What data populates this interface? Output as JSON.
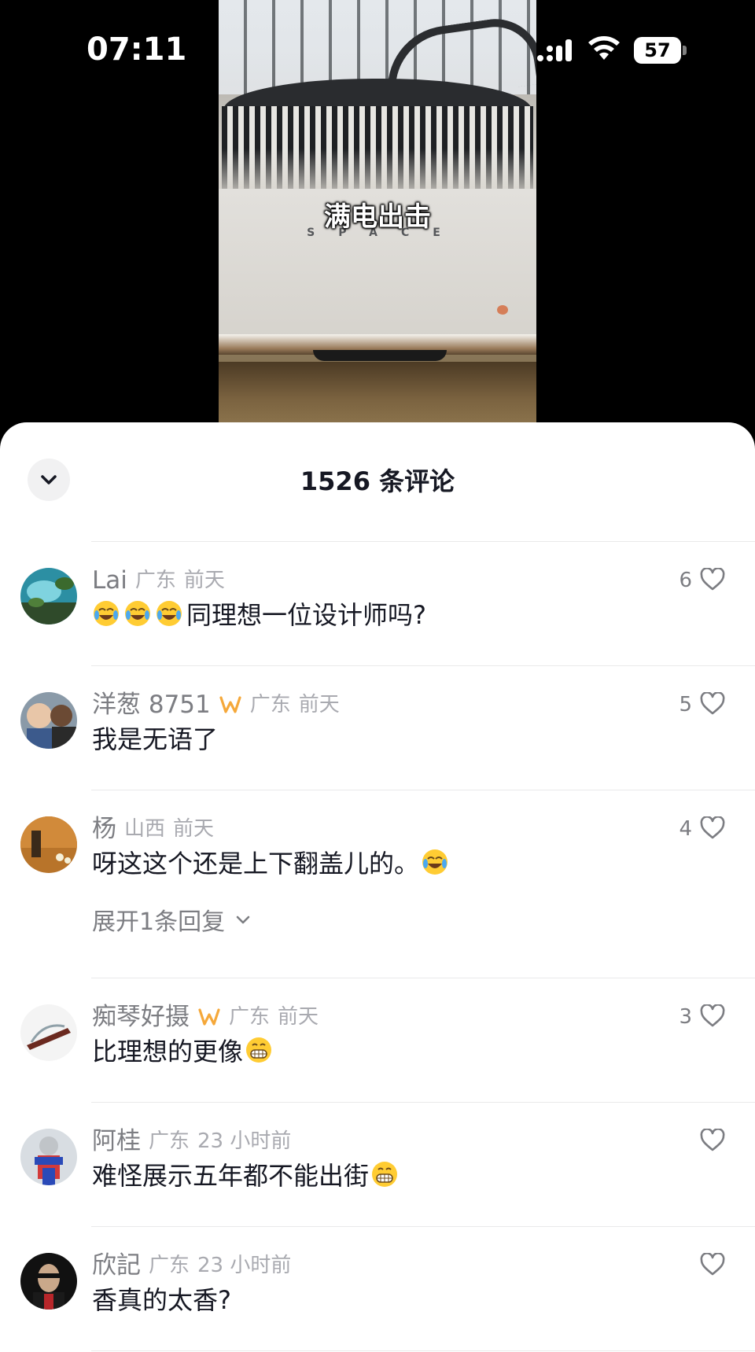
{
  "status_bar": {
    "time": "07:11",
    "battery": "57"
  },
  "video": {
    "caption": "满电出击",
    "car_wordmark": "SPACE"
  },
  "comments_panel": {
    "title": "1526 条评论",
    "comments": [
      {
        "user": "Lai",
        "vip": false,
        "region": "广东",
        "time": "前天",
        "likes": "6",
        "emojis_before": 3,
        "text": "同理想一位设计师吗?",
        "emoji_after": ""
      },
      {
        "user": "洋葱 8751",
        "vip": true,
        "region": "广东",
        "time": "前天",
        "likes": "5",
        "emojis_before": 0,
        "text": "我是无语了",
        "emoji_after": ""
      },
      {
        "user": "杨",
        "vip": false,
        "region": "山西",
        "time": "前天",
        "likes": "4",
        "emojis_before": 0,
        "text": "呀这这个还是上下翻盖儿的。",
        "emoji_after": "laughing-crying-emoji",
        "replies_label": "展开1条回复"
      },
      {
        "user": "痴琴好摄",
        "vip": true,
        "region": "广东",
        "time": "前天",
        "likes": "3",
        "emojis_before": 0,
        "text": "比理想的更像",
        "emoji_after": "grinning-emoji"
      },
      {
        "user": "阿桂",
        "vip": false,
        "region": "广东",
        "time": "23 小时前",
        "likes": "",
        "emojis_before": 0,
        "text": "难怪展示五年都不能出街",
        "emoji_after": "grinning-emoji"
      },
      {
        "user": "欣記",
        "vip": false,
        "region": "广东",
        "time": "23 小时前",
        "likes": "",
        "emojis_before": 0,
        "text": "香真的太香?",
        "emoji_after": ""
      }
    ]
  },
  "colors": {
    "sheet_bg": "#ffffff",
    "text_primary": "#161823",
    "text_secondary": "#7c7d82",
    "vip_accent": "#f5a83a"
  }
}
